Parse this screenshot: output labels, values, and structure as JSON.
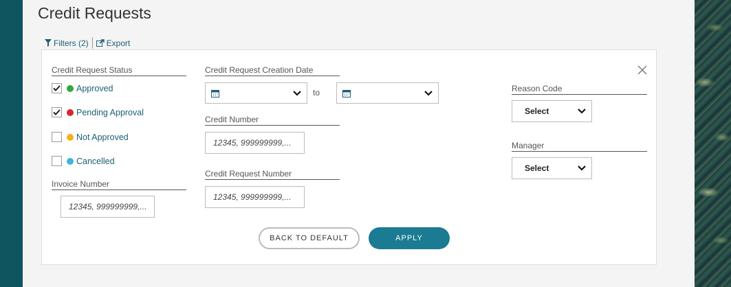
{
  "page": {
    "title": "Credit Requests"
  },
  "toolbar": {
    "filters_label": "Filters (2)",
    "export_label": "Export"
  },
  "status": {
    "label": "Credit Request Status",
    "options": [
      {
        "label": "Approved",
        "checked": true,
        "color": "#2eaa3c"
      },
      {
        "label": "Pending Approval",
        "checked": true,
        "color": "#d9262a"
      },
      {
        "label": "Not Approved",
        "checked": false,
        "color": "#f5b01a"
      },
      {
        "label": "Cancelled",
        "checked": false,
        "color": "#3bb6dc"
      }
    ]
  },
  "invoice": {
    "label": "Invoice Number",
    "placeholder": "12345, 999999999,..."
  },
  "creation_date": {
    "label": "Credit Request Creation Date",
    "from_value": "",
    "to_label": "to",
    "to_value": ""
  },
  "credit_number": {
    "label": "Credit Number",
    "placeholder": "12345, 999999999,..."
  },
  "credit_request_number": {
    "label": "Credit Request Number",
    "placeholder": "12345, 999999999,..."
  },
  "reason_code": {
    "label": "Reason Code",
    "selected": "Select"
  },
  "manager": {
    "label": "Manager",
    "selected": "Select"
  },
  "actions": {
    "default_label": "BACK TO DEFAULT",
    "apply_label": "APPLY"
  },
  "colors": {
    "accent": "#1b7b92",
    "link": "#1b5f73"
  }
}
